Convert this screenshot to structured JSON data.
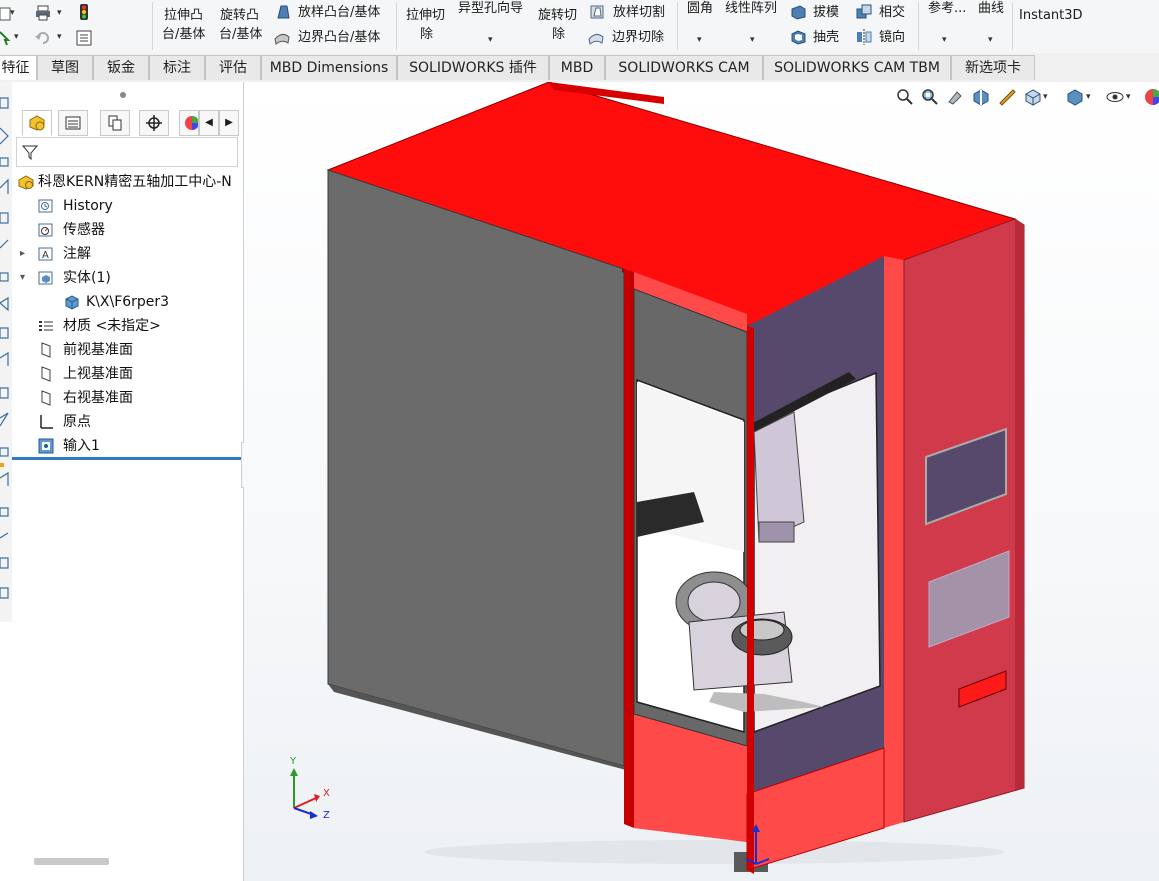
{
  "ribbon": {
    "extrude_boss_l1": "拉伸凸",
    "extrude_boss_l2": "台/基体",
    "revolve_boss_l1": "旋转凸",
    "revolve_boss_l2": "台/基体",
    "loft_boss": "放样凸台/基体",
    "boundary_boss": "边界凸台/基体",
    "extrude_cut_l1": "拉伸切",
    "extrude_cut_l2": "除",
    "hole_wizard": "异型孔向导",
    "revolve_cut_l1": "旋转切",
    "revolve_cut_l2": "除",
    "loft_cut": "放样切割",
    "boundary_cut": "边界切除",
    "fillet": "圆角",
    "linear_pattern": "线性阵列",
    "draft": "拔模",
    "shell": "抽壳",
    "intersect": "相交",
    "mirror": "镜向",
    "reference": "参考...",
    "curves": "曲线",
    "instant3d": "Instant3D"
  },
  "tabs": [
    {
      "label": "特征",
      "active": true
    },
    {
      "label": "草图"
    },
    {
      "label": "钣金"
    },
    {
      "label": "标注"
    },
    {
      "label": "评估"
    },
    {
      "label": "MBD Dimensions"
    },
    {
      "label": "SOLIDWORKS 插件"
    },
    {
      "label": "MBD"
    },
    {
      "label": "SOLIDWORKS CAM"
    },
    {
      "label": "SOLIDWORKS CAM TBM"
    },
    {
      "label": "新选项卡"
    }
  ],
  "tree": {
    "root": "科恩KERN精密五轴加工中心-N",
    "items": [
      {
        "label": "History",
        "icon": "history-icon"
      },
      {
        "label": "传感器",
        "icon": "sensor-icon"
      },
      {
        "label": "注解",
        "icon": "annotation-icon",
        "expander": "▸"
      },
      {
        "label": "实体(1)",
        "icon": "solid-bodies-icon",
        "expander": "▾"
      },
      {
        "label": "K\\X\\F6rper3",
        "icon": "body-icon"
      },
      {
        "label": "材质 <未指定>",
        "icon": "material-icon"
      },
      {
        "label": "前视基准面",
        "icon": "plane-icon"
      },
      {
        "label": "上视基准面",
        "icon": "plane-icon"
      },
      {
        "label": "右视基准面",
        "icon": "plane-icon"
      },
      {
        "label": "原点",
        "icon": "origin-icon"
      },
      {
        "label": "输入1",
        "icon": "import-feature-icon"
      }
    ]
  },
  "triad": {
    "x": "X",
    "y": "Y",
    "z": "Z"
  },
  "colors": {
    "accent_blue": "#2f7cc4",
    "machine_red": "#ff0c0c",
    "side_red": "#d13a4a",
    "gray_panel": "#6b6b6b"
  }
}
